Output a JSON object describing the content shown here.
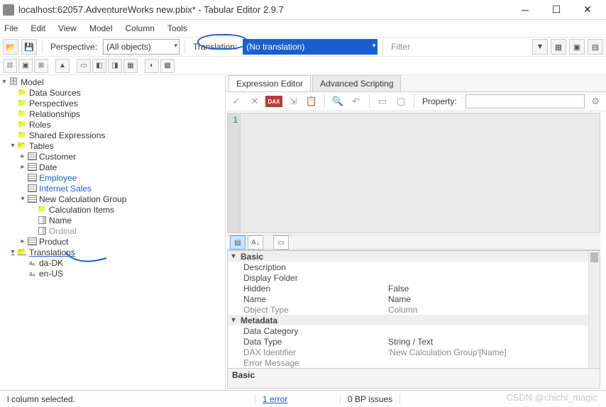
{
  "title": "localhost:62057.AdventureWorks new.pbix* - Tabular Editor 2.9.7",
  "menu": {
    "file": "File",
    "edit": "Edit",
    "view": "View",
    "model": "Model",
    "column": "Column",
    "tools": "Tools"
  },
  "toolbar": {
    "perspective_label": "Perspective:",
    "perspective_value": "(All objects)",
    "translation_label": "Translation:",
    "translation_value": "(No translation)",
    "filter_label": "Filter"
  },
  "tree": {
    "root": "Model",
    "data_sources": "Data Sources",
    "perspectives": "Perspectives",
    "relationships": "Relationships",
    "roles": "Roles",
    "shared_expressions": "Shared Expressions",
    "tables": "Tables",
    "customer": "Customer",
    "date": "Date",
    "employee": "Employee",
    "internet_sales": "Internet Sales",
    "new_calc_group": "New Calculation Group",
    "calc_items": "Calculation Items",
    "name_col": "Name",
    "ordinal_col": "Ordinal",
    "product": "Product",
    "translations": "Translations",
    "da_dk": "da-DK",
    "en_us": "en-US"
  },
  "tabs": {
    "expr": "Expression Editor",
    "adv": "Advanced Scripting"
  },
  "editor": {
    "line1": "1",
    "property_label": "Property:",
    "dax": "DAX"
  },
  "props": {
    "basic": "Basic",
    "description": "Description",
    "display_folder": "Display Folder",
    "hidden": "Hidden",
    "hidden_val": "False",
    "name": "Name",
    "name_val": "Name",
    "object_type": "Object Type",
    "object_type_val": "Column",
    "metadata": "Metadata",
    "data_category": "Data Category",
    "data_type": "Data Type",
    "data_type_val": "String / Text",
    "dax_identifier": "DAX Identifier",
    "dax_identifier_val": "'New Calculation Group'[Name]",
    "error_message": "Error Message",
    "footer": "Basic"
  },
  "status": {
    "selection": "l column selected.",
    "errors": "1 error",
    "bp": "0 BP issues"
  },
  "watermark": "CSDN @chichi_magic"
}
